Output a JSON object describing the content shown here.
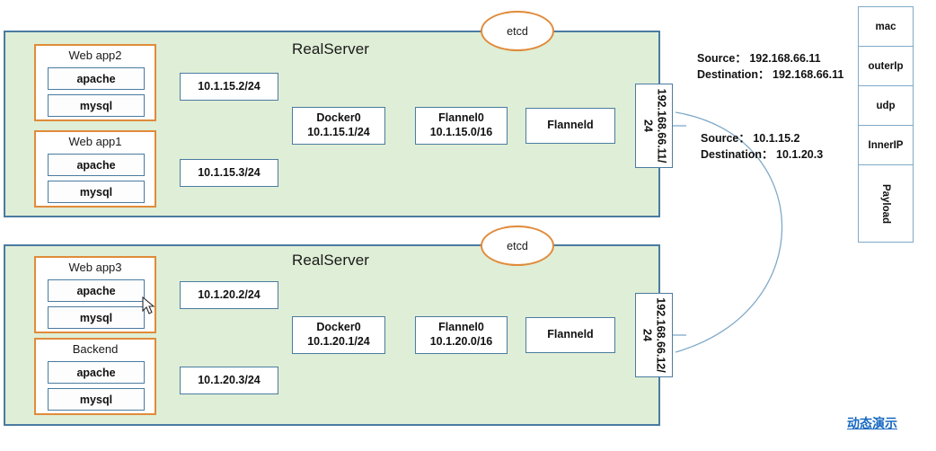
{
  "diagram": {
    "title_top": "RealServer",
    "title_bottom": "RealServer",
    "etcd_top_label": "etcd",
    "etcd_bottom_label": "etcd",
    "demo_link": "动态演示",
    "accent_green": "#dfeed6",
    "accent_blue": "#4a7ba0",
    "accent_orange": "#e08b3a",
    "link_color": "#1668c1"
  },
  "top_server": {
    "apps": [
      {
        "name": "Web app2",
        "services": [
          "apache",
          "mysql"
        ],
        "ip": "10.1.15.2/24"
      },
      {
        "name": "Web app1",
        "services": [
          "apache",
          "mysql"
        ],
        "ip": "10.1.15.3/24"
      }
    ],
    "docker": {
      "name": "Docker0",
      "ip": "10.1.15.1/24"
    },
    "flannel0": {
      "name": "Flannel0",
      "ip": "10.1.15.0/16"
    },
    "flanneld": {
      "name": "Flanneld"
    },
    "host": {
      "ip": "192.168.66.11/",
      "mask": "24"
    }
  },
  "bottom_server": {
    "apps": [
      {
        "name": "Web app3",
        "services": [
          "apache",
          "mysql"
        ],
        "ip": "10.1.20.2/24"
      },
      {
        "name": "Backend",
        "services": [
          "apache",
          "mysql"
        ],
        "ip": "10.1.20.3/24"
      }
    ],
    "docker": {
      "name": "Docker0",
      "ip": "10.1.20.1/24"
    },
    "flannel0": {
      "name": "Flannel0",
      "ip": "10.1.20.0/16"
    },
    "flanneld": {
      "name": "Flanneld"
    },
    "host": {
      "ip": "192.168.66.12/",
      "mask": "24"
    }
  },
  "annotations": {
    "outer_header": {
      "source_line": "Source： 192.168.66.11",
      "destination_line": "Destination： 192.168.66.11"
    },
    "inner_header": {
      "source_line": "Source： 10.1.15.2",
      "destination_line": "Destination： 10.1.20.3"
    }
  },
  "packet_stack": {
    "layers": [
      "mac",
      "outerIp",
      "udp",
      "InnerIP",
      "Payload"
    ]
  }
}
